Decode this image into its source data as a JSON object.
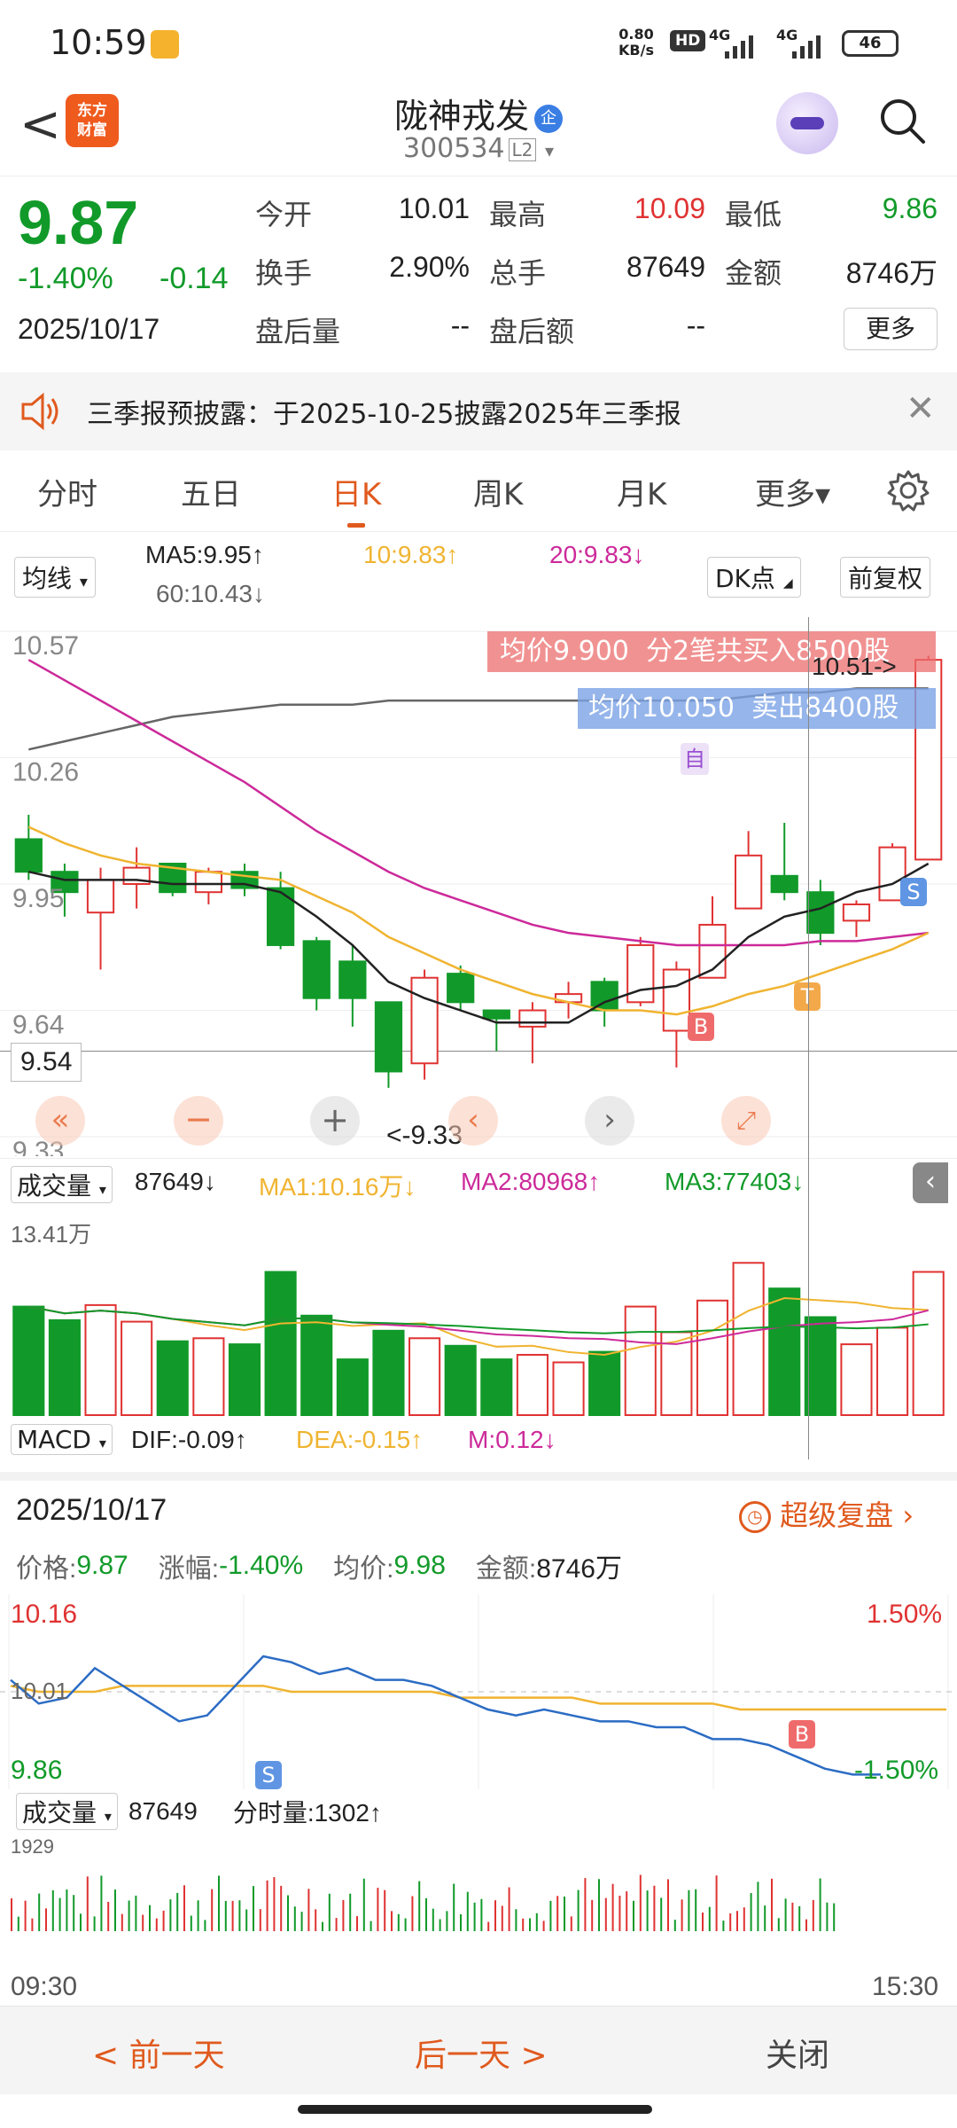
{
  "status": {
    "time": "10:59",
    "net_speed_top": "0.80",
    "net_speed_bottom": "KB/s",
    "hd": "HD",
    "sig1": "4G",
    "sig2": "4G",
    "battery": "46"
  },
  "header": {
    "logo_text_1": "东方",
    "logo_text_2": "财富",
    "stock_name": "陇神戎发",
    "badge": "企",
    "stock_code": "300534",
    "level": "L2"
  },
  "quote": {
    "price": "9.87",
    "change_pct": "-1.40%",
    "change_amt": "-0.14",
    "date": "2025/10/17",
    "fields": [
      {
        "label": "今开",
        "value": "10.01",
        "color": "#222222"
      },
      {
        "label": "最高",
        "value": "10.09",
        "color": "#e03232"
      },
      {
        "label": "最低",
        "value": "9.86",
        "color": "#119a29"
      },
      {
        "label": "换手",
        "value": "2.90%",
        "color": "#222222"
      },
      {
        "label": "总手",
        "value": "87649",
        "color": "#222222"
      },
      {
        "label": "金额",
        "value": "8746万",
        "color": "#222222"
      },
      {
        "label": "盘后量",
        "value": "--",
        "color": "#222222"
      },
      {
        "label": "盘后额",
        "value": "--",
        "color": "#222222"
      }
    ],
    "more_label": "更多"
  },
  "notice": {
    "text": "三季报预披露：于2025-10-25披露2025年三季报"
  },
  "tabs": [
    {
      "label": "分时",
      "active": false
    },
    {
      "label": "五日",
      "active": false
    },
    {
      "label": "日K",
      "active": true
    },
    {
      "label": "周K",
      "active": false
    },
    {
      "label": "月K",
      "active": false
    },
    {
      "label": "更多▾",
      "active": false
    }
  ],
  "kline": {
    "ma_select": "均线",
    "ma5": "MA5:9.95↑",
    "ma10": "10:9.83↑",
    "ma20": "20:9.83↓",
    "ma60": "60:10.43↓",
    "dk_label": "DK点",
    "adj_label": "前复权",
    "y_labels": [
      "10.57",
      "10.26",
      "9.95",
      "9.64",
      "9.33"
    ],
    "cursor_price": "9.54",
    "low_marker": "<-9.33",
    "high_marker": "10.51->",
    "buy_tip": "均价9.900  分2笔共买入8500股",
    "sell_tip": "均价10.050  卖出8400股",
    "badge_zi": "自",
    "badge_b": "B",
    "badge_t": "T",
    "badge_s": "S",
    "colors": {
      "up": "#e03232",
      "down": "#119a29",
      "ma5": "#222222",
      "ma10": "#f0b431",
      "ma20": "#cc2a9a",
      "ma60": "#666666"
    }
  },
  "volume": {
    "label": "成交量",
    "value": "87649↓",
    "ma1": "MA1:10.16万↓",
    "ma2": "MA2:80968↑",
    "ma3": "MA3:77403↓",
    "max_label": "13.41万"
  },
  "macd": {
    "label": "MACD",
    "dif": "DIF:-0.09↑",
    "dea": "DEA:-0.15↑",
    "m": "M:0.12↓"
  },
  "day": {
    "date": "2025/10/17",
    "replay": "超级复盘",
    "price_label": "价格:",
    "price": "9.87",
    "chg_label": "涨幅:",
    "chg": "-1.40%",
    "avg_label": "均价:",
    "avg": "9.98",
    "amt_label": "金额:",
    "amt": "8746万",
    "y_top": "10.16",
    "y_mid": "10.01",
    "y_bottom": "9.86",
    "pct_top": "1.50%",
    "pct_bottom": "-1.50%",
    "badge_s": "S",
    "badge_b": "B",
    "vol_label": "成交量",
    "vol_value": "87649",
    "tick_vol": "分时量:1302↑",
    "vol_max": "1929",
    "time_start": "09:30",
    "time_end": "15:30"
  },
  "bottom": {
    "prev": "< 前一天",
    "next": "后一天 >",
    "close": "关闭"
  },
  "chart_data": {
    "type": "candlestick",
    "ylim": [
      9.33,
      10.57
    ],
    "candles": [
      {
        "o": 10.06,
        "c": 9.98,
        "h": 10.12,
        "l": 9.96
      },
      {
        "o": 9.98,
        "c": 9.93,
        "h": 10.0,
        "l": 9.87
      },
      {
        "o": 9.88,
        "c": 9.96,
        "h": 9.99,
        "l": 9.74
      },
      {
        "o": 9.95,
        "c": 9.99,
        "h": 10.04,
        "l": 9.89
      },
      {
        "o": 10.0,
        "c": 9.93,
        "h": 10.0,
        "l": 9.92
      },
      {
        "o": 9.93,
        "c": 9.98,
        "h": 9.99,
        "l": 9.9
      },
      {
        "o": 9.98,
        "c": 9.94,
        "h": 10.0,
        "l": 9.92
      },
      {
        "o": 9.94,
        "c": 9.8,
        "h": 9.98,
        "l": 9.79
      },
      {
        "o": 9.81,
        "c": 9.67,
        "h": 9.82,
        "l": 9.64
      },
      {
        "o": 9.76,
        "c": 9.67,
        "h": 9.8,
        "l": 9.6
      },
      {
        "o": 9.66,
        "c": 9.49,
        "h": 9.66,
        "l": 9.45
      },
      {
        "o": 9.51,
        "c": 9.72,
        "h": 9.74,
        "l": 9.47
      },
      {
        "o": 9.73,
        "c": 9.66,
        "h": 9.75,
        "l": 9.64
      },
      {
        "o": 9.64,
        "c": 9.62,
        "h": 9.64,
        "l": 9.54
      },
      {
        "o": 9.6,
        "c": 9.64,
        "h": 9.66,
        "l": 9.51
      },
      {
        "o": 9.66,
        "c": 9.68,
        "h": 9.71,
        "l": 9.62
      },
      {
        "o": 9.71,
        "c": 9.64,
        "h": 9.72,
        "l": 9.6
      },
      {
        "o": 9.66,
        "c": 9.8,
        "h": 9.82,
        "l": 9.65
      },
      {
        "o": 9.59,
        "c": 9.74,
        "h": 9.76,
        "l": 9.5
      },
      {
        "o": 9.72,
        "c": 9.85,
        "h": 9.92,
        "l": 9.72
      },
      {
        "o": 9.89,
        "c": 10.02,
        "h": 10.08,
        "l": 9.89
      },
      {
        "o": 9.97,
        "c": 9.93,
        "h": 10.1,
        "l": 9.91
      },
      {
        "o": 9.93,
        "c": 9.83,
        "h": 9.96,
        "l": 9.8
      },
      {
        "o": 9.86,
        "c": 9.9,
        "h": 9.91,
        "l": 9.82
      },
      {
        "o": 9.91,
        "c": 10.04,
        "h": 10.05,
        "l": 9.91
      },
      {
        "o": 10.01,
        "c": 10.5,
        "h": 10.51,
        "l": 10.01
      }
    ],
    "ma5": [
      9.98,
      9.96,
      9.96,
      9.96,
      9.95,
      9.95,
      9.95,
      9.93,
      9.87,
      9.8,
      9.71,
      9.67,
      9.64,
      9.61,
      9.61,
      9.61,
      9.66,
      9.69,
      9.7,
      9.74,
      9.82,
      9.87,
      9.89,
      9.93,
      9.95,
      10.0
    ],
    "ma10": [
      10.09,
      10.05,
      10.02,
      10.0,
      9.99,
      9.98,
      9.97,
      9.96,
      9.92,
      9.88,
      9.82,
      9.78,
      9.74,
      9.71,
      9.68,
      9.66,
      9.64,
      9.64,
      9.63,
      9.65,
      9.68,
      9.7,
      9.73,
      9.76,
      9.79,
      9.83
    ],
    "ma20": [
      10.5,
      10.45,
      10.4,
      10.35,
      10.3,
      10.25,
      10.2,
      10.14,
      10.08,
      10.03,
      9.98,
      9.94,
      9.91,
      9.88,
      9.85,
      9.83,
      9.82,
      9.81,
      9.8,
      9.8,
      9.8,
      9.8,
      9.81,
      9.81,
      9.82,
      9.83
    ],
    "ma60": [
      10.28,
      10.3,
      10.32,
      10.34,
      10.36,
      10.37,
      10.38,
      10.39,
      10.39,
      10.39,
      10.4,
      10.4,
      10.4,
      10.4,
      10.4,
      10.4,
      10.4,
      10.4,
      10.4,
      10.4,
      10.41,
      10.42,
      10.42,
      10.43,
      10.43,
      10.43
    ],
    "volumes": [
      72000,
      63000,
      73000,
      62000,
      49000,
      51000,
      47000,
      95000,
      66000,
      37000,
      56000,
      51000,
      46000,
      37000,
      40000,
      35000,
      42000,
      72000,
      55000,
      76000,
      101000,
      84000,
      65000,
      47000,
      58000,
      95000
    ],
    "vol_ylim": [
      0,
      134100
    ],
    "intraday_price": [
      10.03,
      9.99,
      10.0,
      10.05,
      10.02,
      9.99,
      9.96,
      9.97,
      10.02,
      10.07,
      10.06,
      10.04,
      10.05,
      10.03,
      10.03,
      10.02,
      10.0,
      9.98,
      9.97,
      9.98,
      9.97,
      9.96,
      9.96,
      9.95,
      9.95,
      9.93,
      9.93,
      9.92,
      9.9,
      9.88,
      9.87,
      9.87
    ],
    "intraday_avg": [
      10.02,
      10.01,
      10.01,
      10.01,
      10.02,
      10.02,
      10.02,
      10.02,
      10.02,
      10.02,
      10.01,
      10.01,
      10.01,
      10.01,
      10.01,
      10.01,
      10.0,
      10.0,
      10.0,
      10.0,
      10.0,
      9.99,
      9.99,
      9.99,
      9.99,
      9.99,
      9.98,
      9.98,
      9.98,
      9.98,
      9.98,
      9.98
    ],
    "intraday_ylim": [
      9.86,
      10.16
    ]
  }
}
